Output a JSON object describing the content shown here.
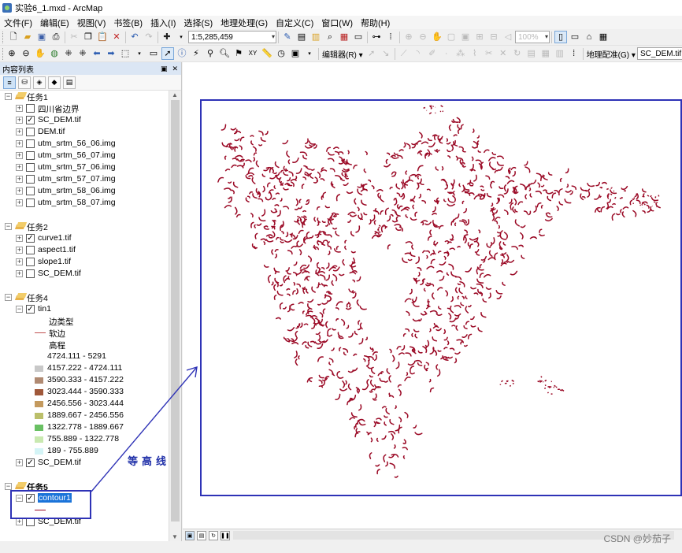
{
  "window": {
    "title": "实验6_1.mxd - ArcMap"
  },
  "menu": [
    "文件(F)",
    "编辑(E)",
    "视图(V)",
    "书签(B)",
    "插入(I)",
    "选择(S)",
    "地理处理(G)",
    "自定义(C)",
    "窗口(W)",
    "帮助(H)"
  ],
  "toolbar": {
    "scale": "1:5,285,459",
    "zoom": "100%",
    "editor_label": "编辑器(R) ▾",
    "georef_label": "地理配准(G) ▾",
    "georef_layer": "SC_DEM.tif"
  },
  "toc": {
    "title": "内容列表",
    "pin": "▣",
    "close": "✕",
    "groups": [
      {
        "name": "任务1",
        "layers": [
          "四川省边界",
          "SC_DEM.tif",
          "DEM.tif",
          "utm_srtm_56_06.img",
          "utm_srtm_56_07.img",
          "utm_srtm_57_06.img",
          "utm_srtm_57_07.img",
          "utm_srtm_58_06.img",
          "utm_srtm_58_07.img"
        ],
        "checked": [
          false,
          true,
          false,
          false,
          false,
          false,
          false,
          false,
          false
        ]
      },
      {
        "name": "任务2",
        "layers": [
          "curve1.tif",
          "aspect1.tif",
          "slope1.tif",
          "SC_DEM.tif"
        ],
        "checked": [
          true,
          false,
          false,
          false
        ]
      },
      {
        "name": "任务4",
        "layers": [
          "tin1",
          "SC_DEM.tif"
        ],
        "checked": [
          true,
          true
        ]
      },
      {
        "name": "任务5",
        "layers": [
          "contour1",
          "SC_DEM.tif"
        ],
        "checked": [
          true,
          false
        ]
      }
    ],
    "tin_legend": {
      "edge_type_heading": "边类型",
      "soft_edge": "软边",
      "elevation_heading": "高程",
      "classes": [
        {
          "label": "4724.111 - 5291",
          "color": "#ffffff"
        },
        {
          "label": "4157.222 - 4724.111",
          "color": "#c8c8c8"
        },
        {
          "label": "3590.333 - 4157.222",
          "color": "#b08a72"
        },
        {
          "label": "3023.444 - 3590.333",
          "color": "#a0583a"
        },
        {
          "label": "2456.556 - 3023.444",
          "color": "#c49a5e"
        },
        {
          "label": "1889.667 - 2456.556",
          "color": "#bbbf6a"
        },
        {
          "label": "1322.778 - 1889.667",
          "color": "#69c063"
        },
        {
          "label": "755.889 - 1322.778",
          "color": "#c9e9b0"
        },
        {
          "label": "189 - 755.889",
          "color": "#d4f4f6"
        }
      ]
    }
  },
  "annotation": {
    "text": "等高线"
  },
  "watermark": "CSDN @妙茄子",
  "colors": {
    "contour": "#9b0a26",
    "frame": "#2e32b6",
    "selection": "#1a73d9"
  }
}
